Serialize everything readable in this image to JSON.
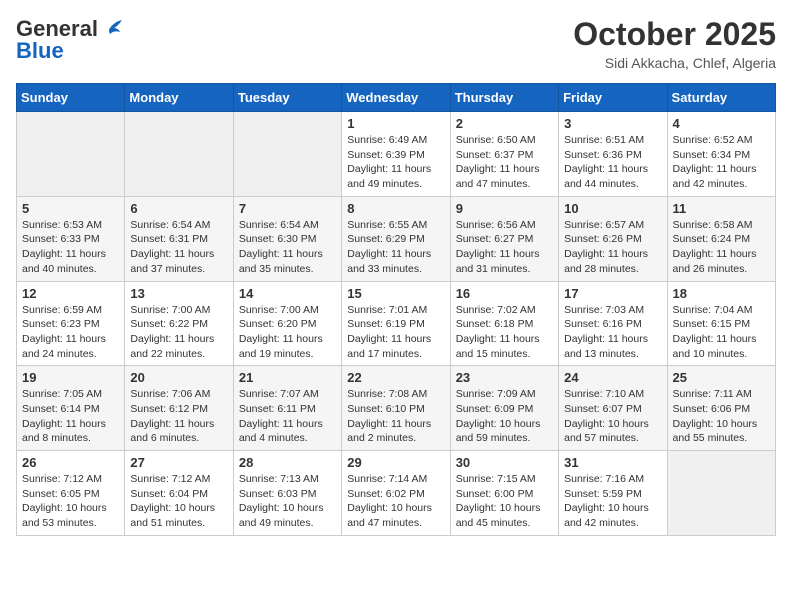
{
  "header": {
    "logo_general": "General",
    "logo_blue": "Blue",
    "month_title": "October 2025",
    "location": "Sidi Akkacha, Chlef, Algeria"
  },
  "days_of_week": [
    "Sunday",
    "Monday",
    "Tuesday",
    "Wednesday",
    "Thursday",
    "Friday",
    "Saturday"
  ],
  "weeks": [
    [
      {
        "day": "",
        "info": ""
      },
      {
        "day": "",
        "info": ""
      },
      {
        "day": "",
        "info": ""
      },
      {
        "day": "1",
        "info": "Sunrise: 6:49 AM\nSunset: 6:39 PM\nDaylight: 11 hours\nand 49 minutes."
      },
      {
        "day": "2",
        "info": "Sunrise: 6:50 AM\nSunset: 6:37 PM\nDaylight: 11 hours\nand 47 minutes."
      },
      {
        "day": "3",
        "info": "Sunrise: 6:51 AM\nSunset: 6:36 PM\nDaylight: 11 hours\nand 44 minutes."
      },
      {
        "day": "4",
        "info": "Sunrise: 6:52 AM\nSunset: 6:34 PM\nDaylight: 11 hours\nand 42 minutes."
      }
    ],
    [
      {
        "day": "5",
        "info": "Sunrise: 6:53 AM\nSunset: 6:33 PM\nDaylight: 11 hours\nand 40 minutes."
      },
      {
        "day": "6",
        "info": "Sunrise: 6:54 AM\nSunset: 6:31 PM\nDaylight: 11 hours\nand 37 minutes."
      },
      {
        "day": "7",
        "info": "Sunrise: 6:54 AM\nSunset: 6:30 PM\nDaylight: 11 hours\nand 35 minutes."
      },
      {
        "day": "8",
        "info": "Sunrise: 6:55 AM\nSunset: 6:29 PM\nDaylight: 11 hours\nand 33 minutes."
      },
      {
        "day": "9",
        "info": "Sunrise: 6:56 AM\nSunset: 6:27 PM\nDaylight: 11 hours\nand 31 minutes."
      },
      {
        "day": "10",
        "info": "Sunrise: 6:57 AM\nSunset: 6:26 PM\nDaylight: 11 hours\nand 28 minutes."
      },
      {
        "day": "11",
        "info": "Sunrise: 6:58 AM\nSunset: 6:24 PM\nDaylight: 11 hours\nand 26 minutes."
      }
    ],
    [
      {
        "day": "12",
        "info": "Sunrise: 6:59 AM\nSunset: 6:23 PM\nDaylight: 11 hours\nand 24 minutes."
      },
      {
        "day": "13",
        "info": "Sunrise: 7:00 AM\nSunset: 6:22 PM\nDaylight: 11 hours\nand 22 minutes."
      },
      {
        "day": "14",
        "info": "Sunrise: 7:00 AM\nSunset: 6:20 PM\nDaylight: 11 hours\nand 19 minutes."
      },
      {
        "day": "15",
        "info": "Sunrise: 7:01 AM\nSunset: 6:19 PM\nDaylight: 11 hours\nand 17 minutes."
      },
      {
        "day": "16",
        "info": "Sunrise: 7:02 AM\nSunset: 6:18 PM\nDaylight: 11 hours\nand 15 minutes."
      },
      {
        "day": "17",
        "info": "Sunrise: 7:03 AM\nSunset: 6:16 PM\nDaylight: 11 hours\nand 13 minutes."
      },
      {
        "day": "18",
        "info": "Sunrise: 7:04 AM\nSunset: 6:15 PM\nDaylight: 11 hours\nand 10 minutes."
      }
    ],
    [
      {
        "day": "19",
        "info": "Sunrise: 7:05 AM\nSunset: 6:14 PM\nDaylight: 11 hours\nand 8 minutes."
      },
      {
        "day": "20",
        "info": "Sunrise: 7:06 AM\nSunset: 6:12 PM\nDaylight: 11 hours\nand 6 minutes."
      },
      {
        "day": "21",
        "info": "Sunrise: 7:07 AM\nSunset: 6:11 PM\nDaylight: 11 hours\nand 4 minutes."
      },
      {
        "day": "22",
        "info": "Sunrise: 7:08 AM\nSunset: 6:10 PM\nDaylight: 11 hours\nand 2 minutes."
      },
      {
        "day": "23",
        "info": "Sunrise: 7:09 AM\nSunset: 6:09 PM\nDaylight: 10 hours\nand 59 minutes."
      },
      {
        "day": "24",
        "info": "Sunrise: 7:10 AM\nSunset: 6:07 PM\nDaylight: 10 hours\nand 57 minutes."
      },
      {
        "day": "25",
        "info": "Sunrise: 7:11 AM\nSunset: 6:06 PM\nDaylight: 10 hours\nand 55 minutes."
      }
    ],
    [
      {
        "day": "26",
        "info": "Sunrise: 7:12 AM\nSunset: 6:05 PM\nDaylight: 10 hours\nand 53 minutes."
      },
      {
        "day": "27",
        "info": "Sunrise: 7:12 AM\nSunset: 6:04 PM\nDaylight: 10 hours\nand 51 minutes."
      },
      {
        "day": "28",
        "info": "Sunrise: 7:13 AM\nSunset: 6:03 PM\nDaylight: 10 hours\nand 49 minutes."
      },
      {
        "day": "29",
        "info": "Sunrise: 7:14 AM\nSunset: 6:02 PM\nDaylight: 10 hours\nand 47 minutes."
      },
      {
        "day": "30",
        "info": "Sunrise: 7:15 AM\nSunset: 6:00 PM\nDaylight: 10 hours\nand 45 minutes."
      },
      {
        "day": "31",
        "info": "Sunrise: 7:16 AM\nSunset: 5:59 PM\nDaylight: 10 hours\nand 42 minutes."
      },
      {
        "day": "",
        "info": ""
      }
    ]
  ]
}
